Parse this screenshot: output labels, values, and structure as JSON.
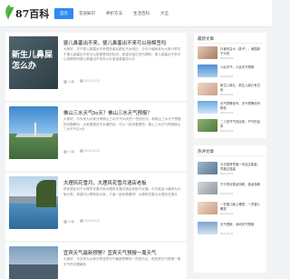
{
  "site": {
    "logo_text": "87百科",
    "brand_color": "#2f8bf2"
  },
  "nav": [
    {
      "label": "首页",
      "active": true
    },
    {
      "label": "花语知识"
    },
    {
      "label": "养护方法"
    },
    {
      "label": "生活百科"
    },
    {
      "label": "大全"
    }
  ],
  "articles": [
    {
      "title": "婴儿鼻塞出不来，婴儿鼻塞出不来可以用棉签吗",
      "excerpt": "大家好，关于婴儿鼻塞出不来很多朋友都还不太明白，今天小编就来为大家分享关于婴儿鼻塞出不来可以用棉签吗的知识，希望对各位有所帮助！婴儿鼻塞出不来可以用棉签吗婴儿鼻塞出不来怎么办宝宝鼻塞怎么办",
      "thumb_text_line1": "新生儿鼻屎",
      "thumb_text_line2": "怎么办",
      "author": "小编",
      "date": "2024-03-22"
    },
    {
      "title": "佛山三水天气5o天？佛山三水天气预报？",
      "excerpt": "大家好，今天来为大家分享佛山三水天气5o天的一些知识点，和佛山三水天气预报的问题解析，大家要是还不太懂的话，可以一起来看看吧。佛山三水天气预报佛山三水天气五o天",
      "author": "小编",
      "date": "2024-03-22"
    },
    {
      "title": "大理风花雪月，大理风花雪月酒店老板",
      "excerpt": "很多朋友对于大理风花雪月和大理风花雪月酒店老板不太懂，今天就由小编来为大家分享，希望可以帮助到大家，下面一起来看看吧！大理风花雪月大理风花雪月",
      "author": "小编",
      "date": "2024-03-22"
    },
    {
      "title": "宜宾天气最新预警？宜宾天气预报一周天气",
      "excerpt": "大家好，今天来为大家分享宜宾天气最新预警的一些知识点，和宜宾天气预报一周天气的问题解析",
      "author": "小编",
      "date": "2024-03-22"
    }
  ],
  "sidebar": {
    "recent_title": "最新文章",
    "recent": [
      {
        "text": "抖音布吉大（鼻子），美国鼻子大的",
        "date": "2024-03-22"
      },
      {
        "text": "人民天气，人民天气预报",
        "date": "2024-03-22"
      },
      {
        "text": "新生儿鼻孔，新生儿鼻孔有白色",
        "date": "2024-03-22"
      },
      {
        "text": "天气预警信号，天气预警信号颜色",
        "date": "2024-03-22"
      },
      {
        "text": "二十四节气的由来，节气的由来",
        "date": "2024-03-22"
      }
    ],
    "hot_title": "热评文章",
    "hot": [
      {
        "text": "今日推荐早晨一句话正能量，早晨正能量",
        "date": "2024-03-22"
      },
      {
        "text": "千万别买德龙特斯，德龙特斯",
        "date": "2024-03-22"
      },
      {
        "text": "一岁婴儿晚上睡觉，一岁婴儿睡觉",
        "date": "2024-03-22"
      },
      {
        "text": "天气预报，深圳天气预报",
        "date": "2024-03-22"
      }
    ]
  }
}
